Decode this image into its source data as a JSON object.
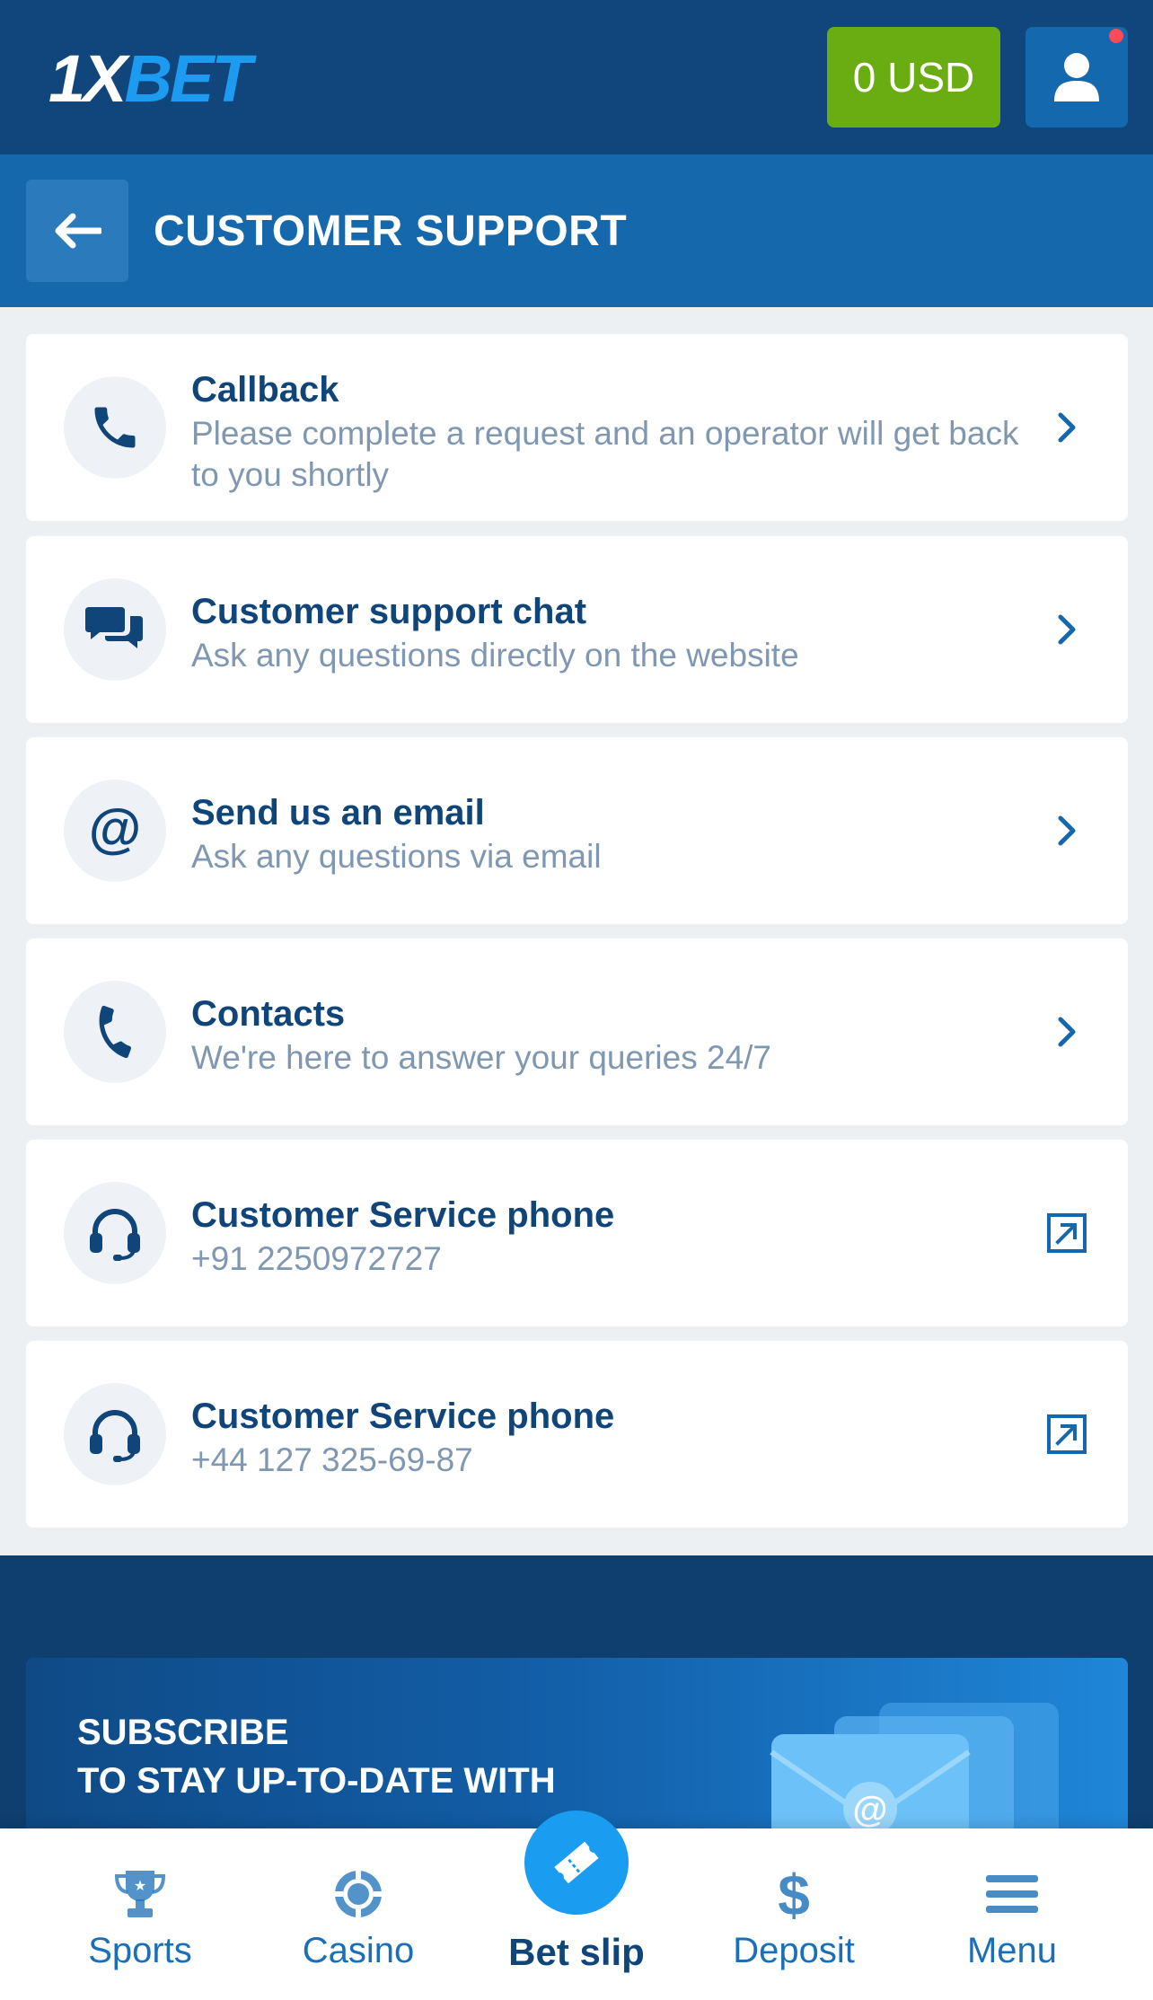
{
  "header": {
    "logo": {
      "part1": "1X",
      "part2": "BET"
    },
    "balance": "0 USD",
    "user_icon": "user-icon",
    "has_notification": true
  },
  "section": {
    "title": "CUSTOMER SUPPORT",
    "back_icon": "arrow-left-icon"
  },
  "items": [
    {
      "icon": "phone-icon",
      "title": "Callback",
      "subtitle": "Please complete a request and an operator will get back to you shortly",
      "action": "chevron-right-icon"
    },
    {
      "icon": "chat-icon",
      "title": "Customer support chat",
      "subtitle": "Ask any questions directly on the website",
      "action": "chevron-right-icon"
    },
    {
      "icon": "at-icon",
      "title": "Send us an email",
      "subtitle": "Ask any questions via email",
      "action": "chevron-right-icon"
    },
    {
      "icon": "phone-tilted-icon",
      "title": "Contacts",
      "subtitle": "We're here to answer your queries 24/7",
      "action": "chevron-right-icon"
    },
    {
      "icon": "headset-icon",
      "title": "Customer Service phone",
      "subtitle": "+91 2250972727",
      "action": "external-link-icon"
    },
    {
      "icon": "headset-icon",
      "title": "Customer Service phone",
      "subtitle": "+44 127 325-69-87",
      "action": "external-link-icon"
    }
  ],
  "subscribe": {
    "line1": "SUBSCRIBE",
    "line2": "TO STAY UP-TO-DATE WITH",
    "image_icon": "envelope-icon"
  },
  "nav": [
    {
      "label": "Sports",
      "icon": "trophy-icon"
    },
    {
      "label": "Casino",
      "icon": "casino-chip-icon"
    },
    {
      "label": "Bet slip",
      "icon": "ticket-icon",
      "active": true
    },
    {
      "label": "Deposit",
      "icon": "dollar-icon"
    },
    {
      "label": "Menu",
      "icon": "hamburger-menu-icon"
    }
  ],
  "colors": {
    "topbar": "#10467b",
    "section_header": "#1568ab",
    "balance_button": "#6aad12",
    "title_text": "#10457a",
    "subtitle_text": "#7f97b0",
    "nav_accent": "#1a9cf0"
  }
}
